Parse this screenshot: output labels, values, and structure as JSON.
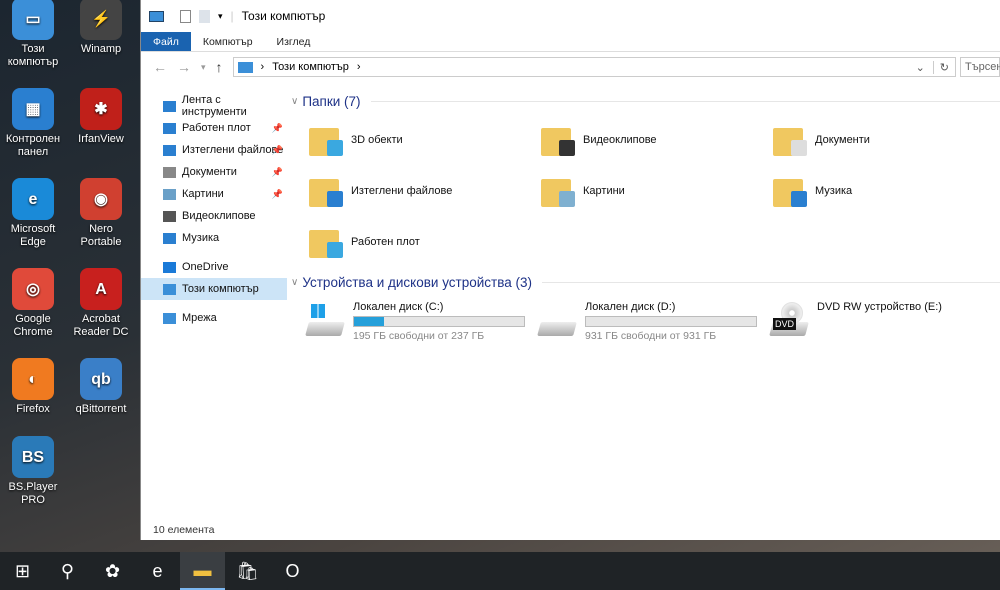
{
  "desktop": [
    {
      "label": "Този компютър",
      "color": "#3b8fd8",
      "glyph": "▭"
    },
    {
      "label": "Winamp",
      "color": "#444",
      "glyph": "⚡"
    },
    {
      "label": "Контролен панел",
      "color": "#2a7fd0",
      "glyph": "▦"
    },
    {
      "label": "IrfanView",
      "color": "#c0201a",
      "glyph": "✱"
    },
    {
      "label": "Microsoft Edge",
      "color": "#1a8ad8",
      "glyph": "e"
    },
    {
      "label": "Nero Portable",
      "color": "#d04030",
      "glyph": "◉"
    },
    {
      "label": "Google Chrome",
      "color": "#e04a3a",
      "glyph": "◎"
    },
    {
      "label": "Acrobat Reader DC",
      "color": "#c8201e",
      "glyph": "A"
    },
    {
      "label": "Firefox",
      "color": "#f07a20",
      "glyph": "◐"
    },
    {
      "label": "qBittorrent",
      "color": "#3a7fc8",
      "glyph": "qb"
    },
    {
      "label": "BS.Player PRO",
      "color": "#2a7ab8",
      "glyph": "BS"
    }
  ],
  "window": {
    "title": "Този компютър",
    "tabs": [
      "Файл",
      "Компютър",
      "Изглед"
    ],
    "address": "Този компютър",
    "search_placeholder": "Търсене",
    "nav": [
      {
        "label": "Лента с инструменти",
        "color": "#2a7fd0",
        "pin": false,
        "bold": false
      },
      {
        "label": "Работен плот",
        "color": "#2a7fd0",
        "pin": true
      },
      {
        "label": "Изтеглени файлове",
        "color": "#2a7fd0",
        "pin": true
      },
      {
        "label": "Документи",
        "color": "#888",
        "pin": true
      },
      {
        "label": "Картини",
        "color": "#6aa0c8",
        "pin": true
      },
      {
        "label": "Видеоклипове",
        "color": "#555",
        "pin": false
      },
      {
        "label": "Музика",
        "color": "#2a7fd0",
        "pin": false
      },
      {
        "label": "OneDrive",
        "color": "#1a7ad8",
        "pin": false
      },
      {
        "label": "Този компютър",
        "color": "#3b8fd8",
        "pin": false,
        "selected": true
      },
      {
        "label": "Мрежа",
        "color": "#3b8fd8",
        "pin": false
      }
    ],
    "folders_header": "Папки (7)",
    "folders": [
      {
        "label": "3D обекти",
        "color": "#3aa8e0"
      },
      {
        "label": "Видеоклипове",
        "color": "#333"
      },
      {
        "label": "Документи",
        "color": "#ddd"
      },
      {
        "label": "Изтеглени файлове",
        "color": "#2a7fd0"
      },
      {
        "label": "Картини",
        "color": "#7fb0d0"
      },
      {
        "label": "Музика",
        "color": "#2a7fd0"
      },
      {
        "label": "Работен плот",
        "color": "#3aa8e0"
      }
    ],
    "devices_header": "Устройства и дискови устройства (3)",
    "drives": [
      {
        "label": "Локален диск (C:)",
        "free": "195 ГБ свободни от 237 ГБ",
        "used_percent": 17.7,
        "type": "system"
      },
      {
        "label": "Локален диск (D:)",
        "free": "931 ГБ свободни от 931 ГБ",
        "used_percent": 0,
        "type": "disk"
      },
      {
        "label": "DVD RW устройство (E:)",
        "type": "dvd",
        "badge": "DVD"
      }
    ],
    "status": "10 елемента"
  },
  "taskbar": [
    {
      "name": "start",
      "glyph": "⊞"
    },
    {
      "name": "search",
      "glyph": "⚲"
    },
    {
      "name": "copilot",
      "glyph": "✿"
    },
    {
      "name": "edge",
      "glyph": "e"
    },
    {
      "name": "explorer",
      "glyph": "▬",
      "active": true
    },
    {
      "name": "store",
      "glyph": "🛍"
    },
    {
      "name": "outlook",
      "glyph": "O"
    }
  ]
}
